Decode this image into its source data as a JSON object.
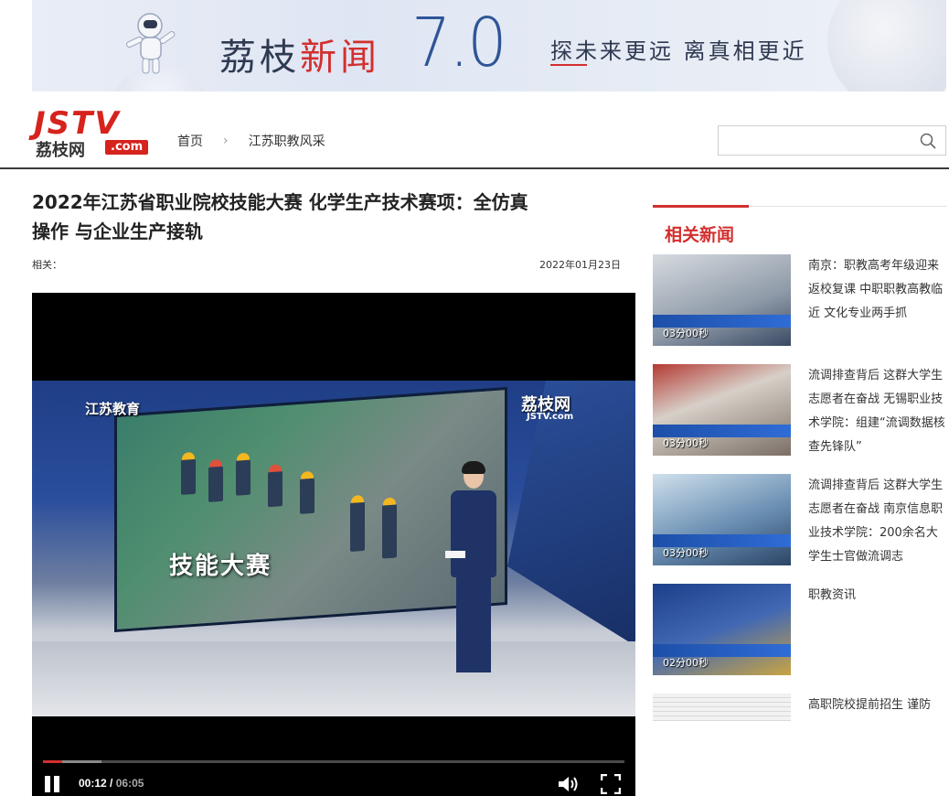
{
  "banner": {
    "title_black": "荔枝",
    "title_red": "新闻",
    "version": "7.0",
    "slogan": "探未来更远  离真相更近"
  },
  "logo": {
    "main": "JSTV",
    "cn": "荔枝网",
    "com": ".com"
  },
  "breadcrumb": {
    "home": "首页",
    "section": "江苏职教风采"
  },
  "search": {
    "value": "",
    "placeholder": ""
  },
  "article": {
    "title": "2022年江苏省职业院校技能大赛 化学生产技术赛项：全仿真操作 与企业生产接轨",
    "related_label": "相关：",
    "date": "2022年01月23日"
  },
  "video": {
    "caption": "技能大赛",
    "channel_logo": "江苏教育",
    "brand": "荔枝网",
    "brand_sub": "JSTV.com",
    "current_time": "00:12",
    "separator": " / ",
    "duration": "06:05",
    "played_fraction": 0.033,
    "buffered_fraction": 0.1
  },
  "sidebar": {
    "heading": "相关新闻",
    "items": [
      {
        "title": "南京：职教高考年级迎来返校复课 中职职教高教临近 文化专业两手抓",
        "duration": "03分00秒"
      },
      {
        "title": "流调排查背后 这群大学生志愿者在奋战 无锡职业技术学院：组建“流调数据核查先锋队”",
        "duration": "03分00秒"
      },
      {
        "title": "流调排查背后 这群大学生志愿者在奋战 南京信息职业技术学院：200余名大学生士官做流调志",
        "duration": "03分00秒"
      },
      {
        "title": "职教资讯",
        "duration": "02分00秒"
      },
      {
        "title": "高职院校提前招生 谨防",
        "duration": ""
      }
    ]
  },
  "colors": {
    "accent": "#d32f2f",
    "brand_blue": "#2f5597"
  }
}
